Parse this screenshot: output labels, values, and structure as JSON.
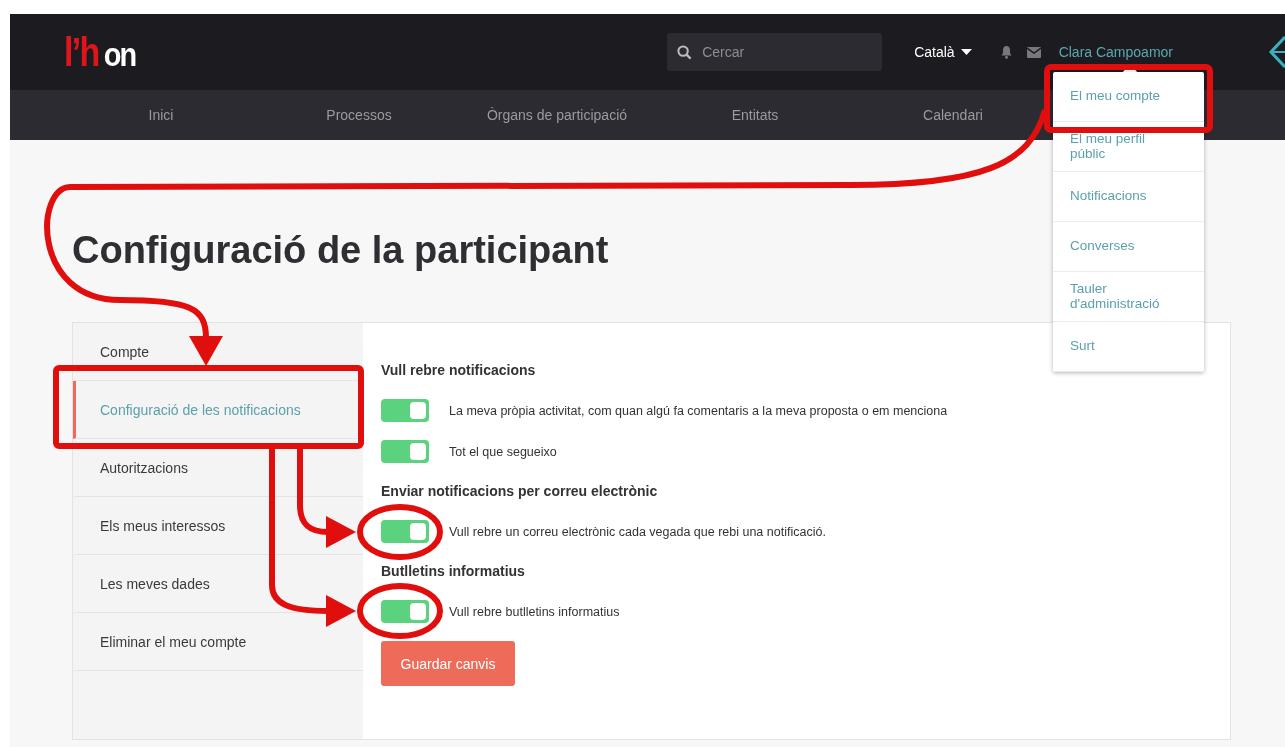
{
  "logo": {
    "accent": "l’h",
    "text": "on"
  },
  "search": {
    "placeholder": "Cercar"
  },
  "language": {
    "label": "Català"
  },
  "user": {
    "name": "Clara Campoamor"
  },
  "nav": [
    {
      "label": "Inici"
    },
    {
      "label": "Processos"
    },
    {
      "label": "Òrgans de participació"
    },
    {
      "label": "Entitats"
    },
    {
      "label": "Calendari"
    }
  ],
  "user_menu": [
    {
      "label": "El meu compte"
    },
    {
      "label": "El meu perfil públic"
    },
    {
      "label": "Notificacions"
    },
    {
      "label": "Converses"
    },
    {
      "label": "Tauler d'administració"
    },
    {
      "label": "Surt"
    }
  ],
  "title": "Configuració de la participant",
  "sidebar": [
    {
      "label": "Compte",
      "selected": false
    },
    {
      "label": "Configuració de les notificacions",
      "selected": true
    },
    {
      "label": "Autoritzacions",
      "selected": false
    },
    {
      "label": "Els meus interessos",
      "selected": false
    },
    {
      "label": "Les meves dades",
      "selected": false
    },
    {
      "label": "Eliminar el meu compte",
      "selected": false
    }
  ],
  "sections": [
    {
      "heading": "Vull rebre notificacions",
      "options": [
        {
          "label": "La meva pròpia activitat, com quan algú fa comentaris a la meva proposta o em menciona",
          "on": true
        },
        {
          "label": "Tot el que segueixo",
          "on": true
        }
      ]
    },
    {
      "heading": "Enviar notificacions per correu electrònic",
      "options": [
        {
          "label": "Vull rebre un correu electrònic cada vegada que rebi una notificació.",
          "on": true
        }
      ]
    },
    {
      "heading": "Butlletins informatius",
      "options": [
        {
          "label": "Vull rebre butlletins informatius",
          "on": true
        }
      ]
    }
  ],
  "save_button": "Guardar canvis"
}
